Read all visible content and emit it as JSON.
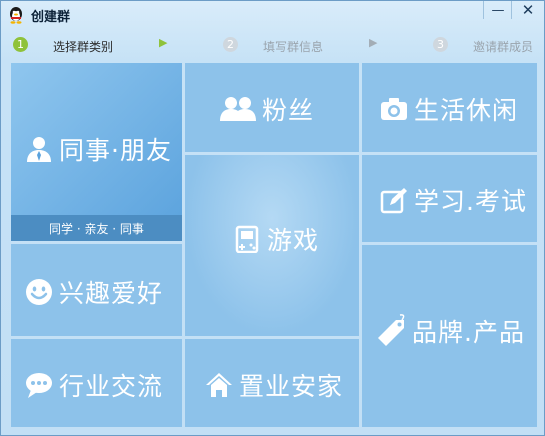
{
  "window": {
    "title": "创建群",
    "minimize_symbol": "—",
    "close_symbol": "✕"
  },
  "steps": [
    {
      "number": "1",
      "label": "选择群类别",
      "active": true
    },
    {
      "number": "2",
      "label": "填写群信息",
      "active": false
    },
    {
      "number": "3",
      "label": "邀请群成员",
      "active": false
    }
  ],
  "step_arrow": "▶",
  "colors": {
    "tile": "#8dc2ea",
    "selected_tile": "#5aa2dd",
    "sub_bar": "#4c8dc2",
    "active_step": "#8fc23a"
  },
  "categories": {
    "colleague_friend": {
      "label": "同事·朋友",
      "subtitle": "同学 · 亲友 · 同事",
      "icon": "person-icon"
    },
    "fans": {
      "label": "粉丝",
      "icon": "people-icon"
    },
    "life_leisure": {
      "label": "生活休闲",
      "icon": "camera-icon"
    },
    "game": {
      "label": "游戏",
      "icon": "gamepad-icon"
    },
    "study_exam": {
      "label": "学习.考试",
      "icon": "edit-icon"
    },
    "interest_hobby": {
      "label": "兴趣爱好",
      "icon": "smile-icon"
    },
    "brand_product": {
      "label": "品牌.产品",
      "icon": "tag-icon"
    },
    "industry_exchange": {
      "label": "行业交流",
      "icon": "chat-icon"
    },
    "real_estate": {
      "label": "置业安家",
      "icon": "house-icon"
    }
  }
}
